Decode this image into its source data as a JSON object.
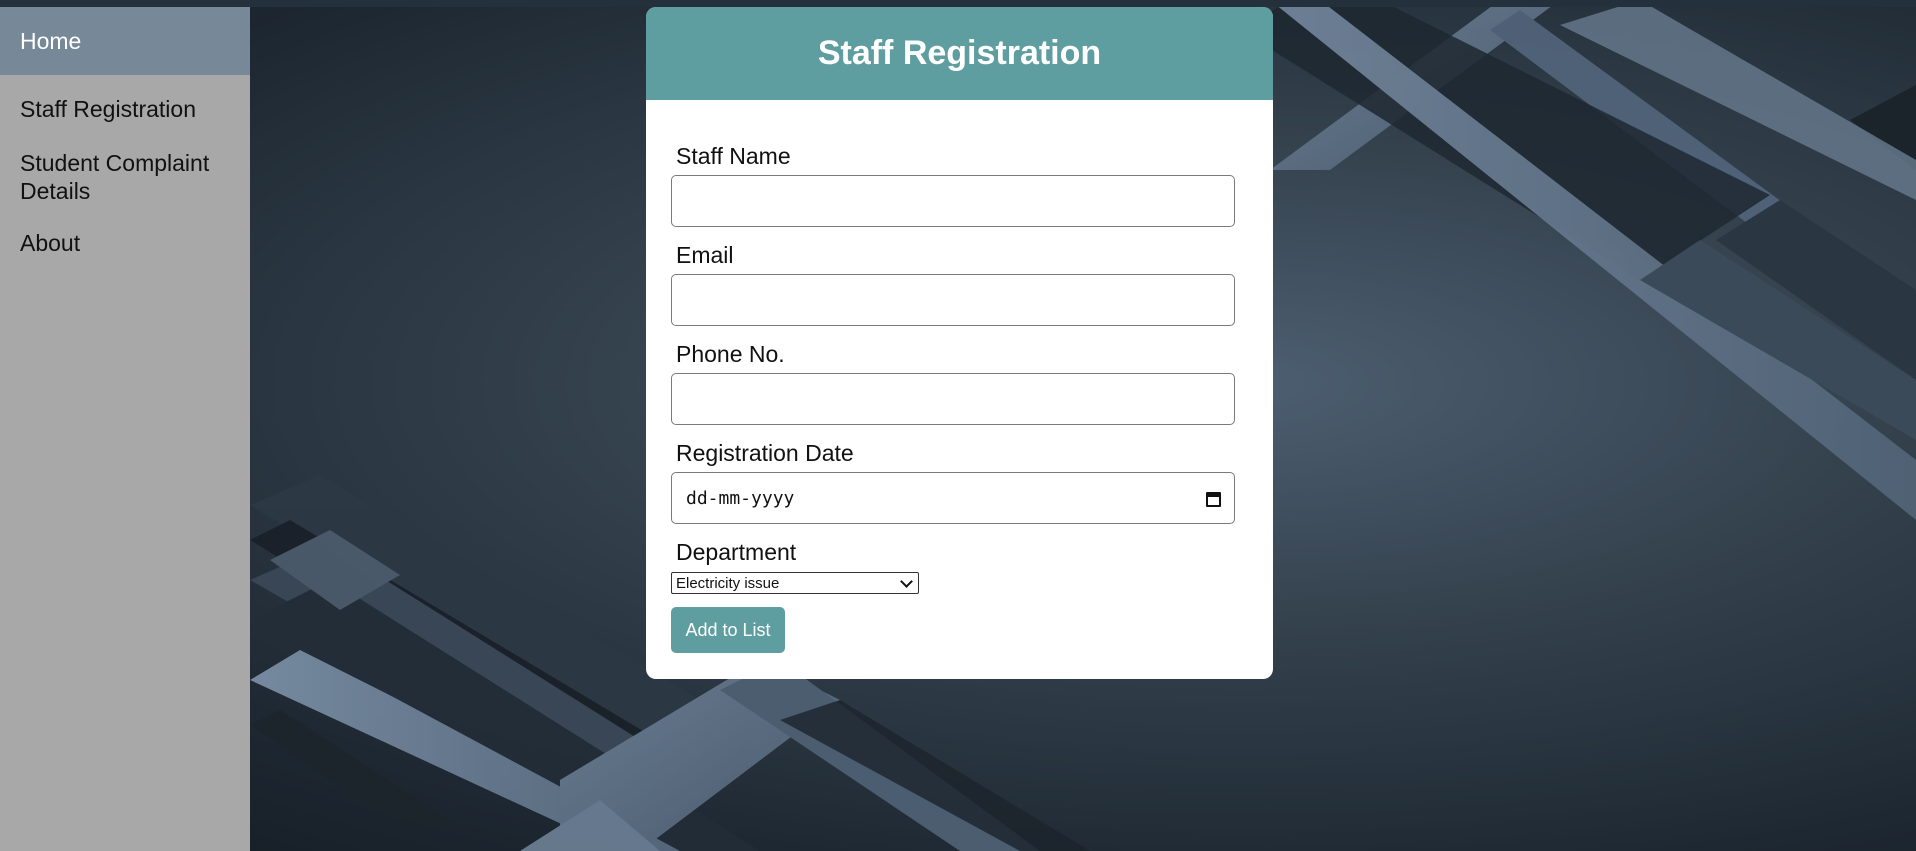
{
  "sidebar": {
    "items": [
      {
        "label": "Home"
      },
      {
        "label": "Staff Registration"
      },
      {
        "label": "Student Complaint Details"
      },
      {
        "label": "About"
      }
    ]
  },
  "form": {
    "title": "Staff Registration",
    "fields": {
      "staff_name": {
        "label": "Staff Name",
        "value": ""
      },
      "email": {
        "label": "Email",
        "value": ""
      },
      "phone": {
        "label": "Phone No.",
        "value": ""
      },
      "registration_date": {
        "label": "Registration Date",
        "placeholder": "dd-mm-yyyy"
      },
      "department": {
        "label": "Department",
        "selected": "Electricity issue"
      }
    },
    "submit_label": "Add to List"
  },
  "colors": {
    "accent": "#5f9ea0",
    "sidebar_bg": "#a8a8a8",
    "sidebar_active": "#778899"
  }
}
